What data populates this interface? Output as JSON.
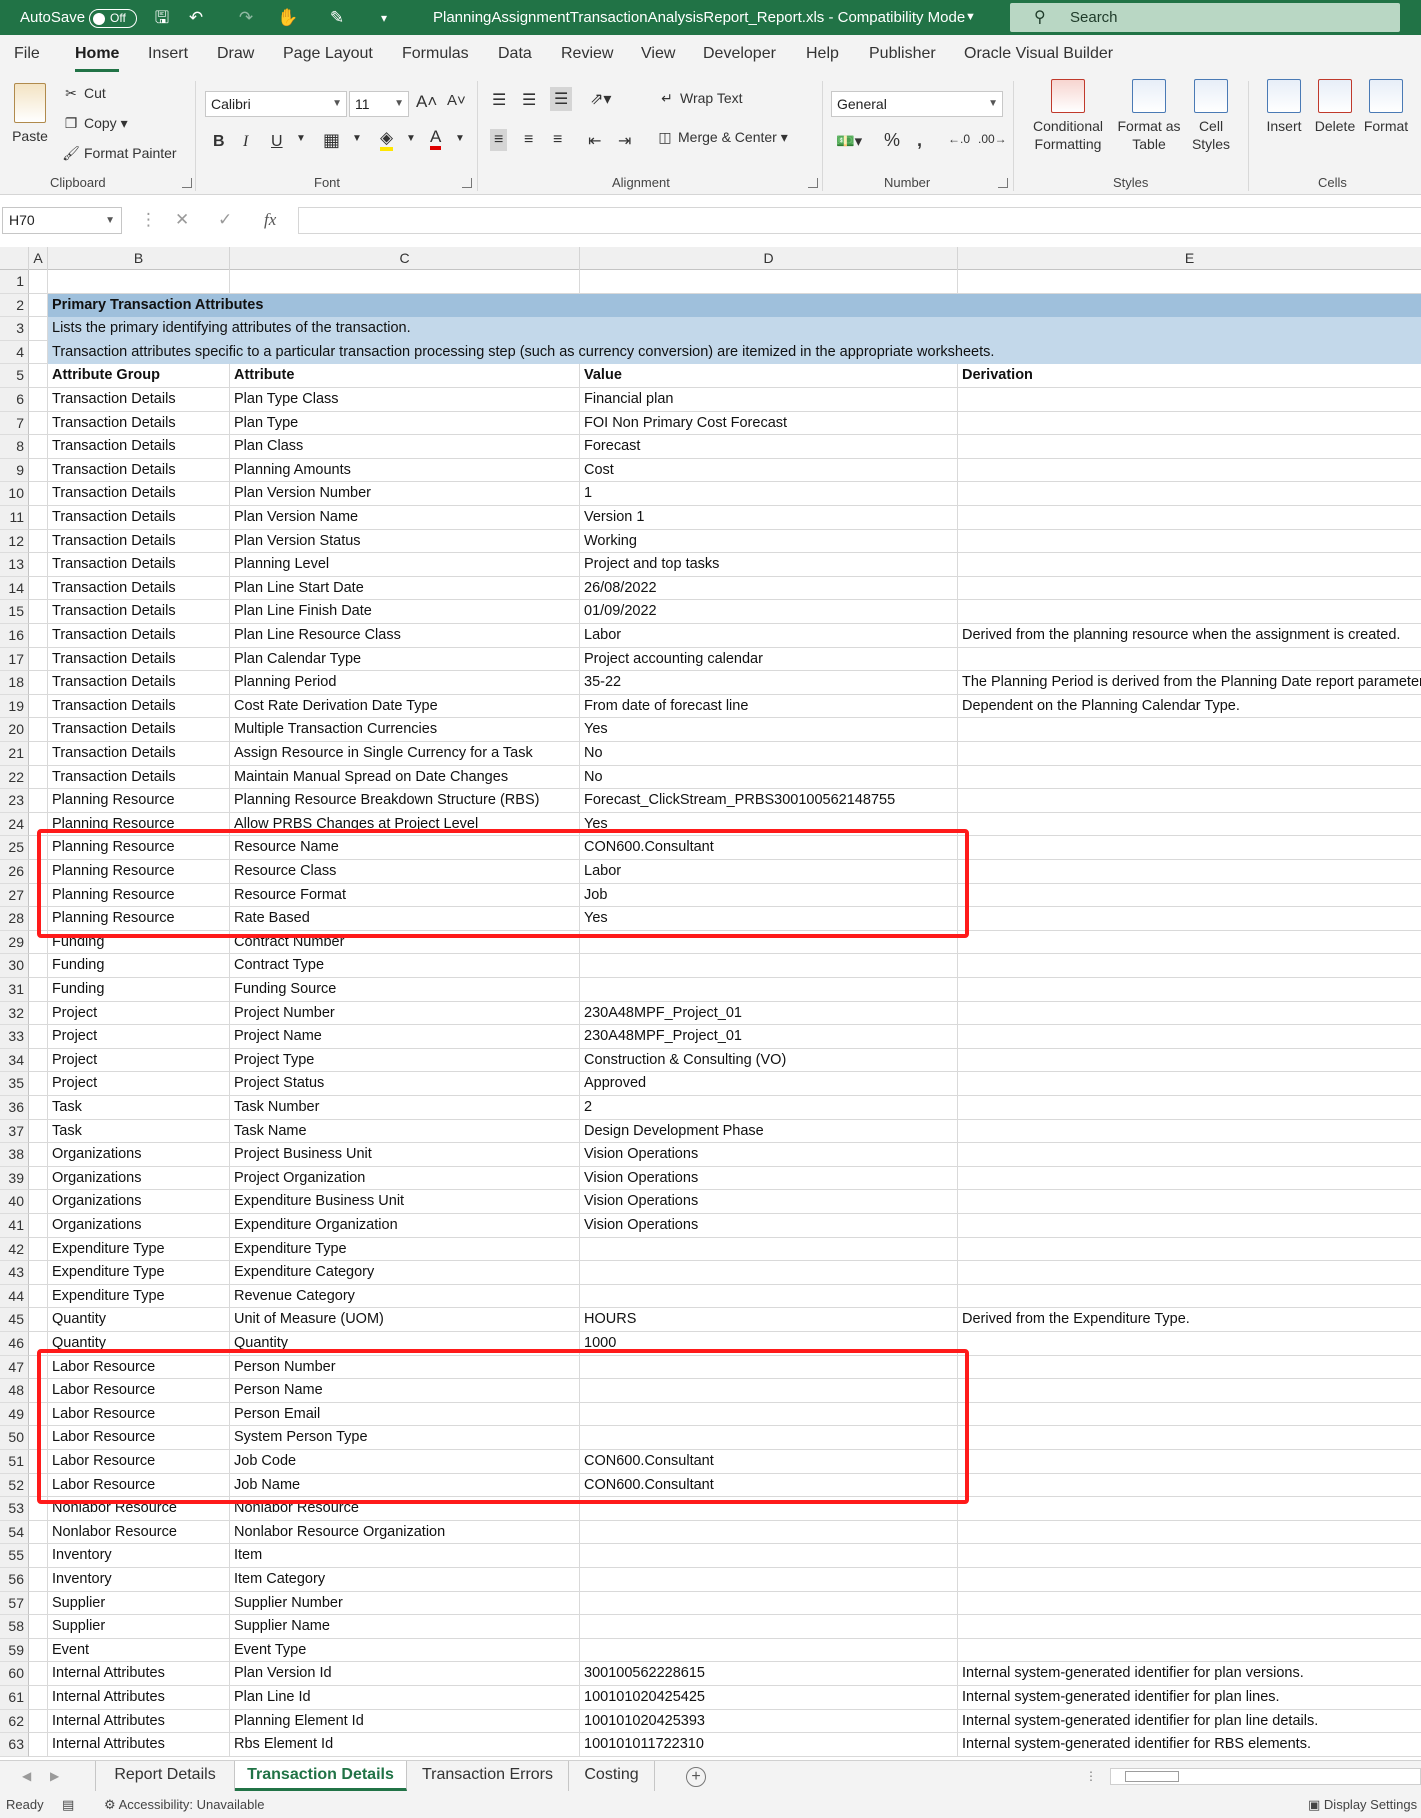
{
  "titlebar": {
    "autosave_label": "AutoSave",
    "autosave_state": "Off",
    "document_title": "PlanningAssignmentTransactionAnalysisReport_Report.xls  -  Compatibility Mode",
    "search_placeholder": "Search"
  },
  "menu": {
    "tabs": [
      "File",
      "Home",
      "Insert",
      "Draw",
      "Page Layout",
      "Formulas",
      "Data",
      "Review",
      "View",
      "Developer",
      "Help",
      "Publisher",
      "Oracle Visual Builder"
    ],
    "active": "Home"
  },
  "ribbon": {
    "clipboard": {
      "paste": "Paste",
      "cut": "Cut",
      "copy": "Copy",
      "format_painter": "Format Painter",
      "label": "Clipboard"
    },
    "font": {
      "name": "Calibri",
      "size": "11",
      "label": "Font",
      "bold": "B",
      "italic": "I",
      "underline": "U"
    },
    "alignment": {
      "wrap_text": "Wrap Text",
      "merge_center": "Merge & Center",
      "label": "Alignment"
    },
    "number": {
      "format": "General",
      "label": "Number"
    },
    "styles": {
      "conditional": "Conditional Formatting",
      "format_table": "Format as Table",
      "cell_styles": "Cell Styles",
      "label": "Styles"
    },
    "cells": {
      "insert": "Insert",
      "delete": "Delete",
      "format": "Format",
      "label": "Cells"
    }
  },
  "formula_bar": {
    "name_box": "H70",
    "fx": "fx",
    "value": ""
  },
  "columns": [
    "A",
    "B",
    "C",
    "D",
    "E"
  ],
  "sheet": {
    "title_row": "Primary Transaction Attributes",
    "desc_row_1": "Lists the primary identifying attributes of the transaction.",
    "desc_row_2": "Transaction attributes specific to a particular transaction processing step (such as currency conversion) are itemized in the appropriate worksheets.",
    "headers": [
      "Attribute Group",
      "Attribute",
      "Value",
      "Derivation"
    ],
    "rows": [
      [
        "Transaction Details",
        "Plan Type Class",
        "Financial plan",
        ""
      ],
      [
        "Transaction Details",
        "Plan Type",
        "FOI Non Primary Cost Forecast",
        ""
      ],
      [
        "Transaction Details",
        "Plan Class",
        "Forecast",
        ""
      ],
      [
        "Transaction Details",
        "Planning Amounts",
        "Cost",
        ""
      ],
      [
        "Transaction Details",
        "Plan Version Number",
        "1",
        ""
      ],
      [
        "Transaction Details",
        "Plan Version Name",
        "Version 1",
        ""
      ],
      [
        "Transaction Details",
        "Plan Version Status",
        "Working",
        ""
      ],
      [
        "Transaction Details",
        "Planning Level",
        "Project and top tasks",
        ""
      ],
      [
        "Transaction Details",
        "Plan Line Start Date",
        "26/08/2022",
        ""
      ],
      [
        "Transaction Details",
        "Plan Line Finish Date",
        "01/09/2022",
        ""
      ],
      [
        "Transaction Details",
        "Plan Line Resource Class",
        "Labor",
        "Derived from the planning resource when the assignment is created."
      ],
      [
        "Transaction Details",
        "Plan Calendar Type",
        "Project accounting calendar",
        ""
      ],
      [
        "Transaction Details",
        "Planning Period",
        "35-22",
        "The Planning Period is derived from the Planning Date report parameter."
      ],
      [
        "Transaction Details",
        "Cost Rate Derivation Date Type",
        "From date of forecast line",
        "Dependent on the Planning Calendar Type."
      ],
      [
        "Transaction Details",
        "Multiple Transaction Currencies",
        "Yes",
        ""
      ],
      [
        "Transaction Details",
        "Assign Resource in Single Currency for a Task",
        "No",
        ""
      ],
      [
        "Transaction Details",
        "Maintain Manual Spread on Date Changes",
        "No",
        ""
      ],
      [
        "Planning Resource",
        "Planning Resource Breakdown Structure (RBS)",
        "Forecast_ClickStream_PRBS300100562148755",
        ""
      ],
      [
        "Planning Resource",
        "Allow PRBS Changes at Project Level",
        "Yes",
        ""
      ],
      [
        "Planning Resource",
        "Resource Name",
        "CON600.Consultant",
        ""
      ],
      [
        "Planning Resource",
        "Resource Class",
        "Labor",
        ""
      ],
      [
        "Planning Resource",
        "Resource Format",
        "Job",
        ""
      ],
      [
        "Planning Resource",
        "Rate Based",
        "Yes",
        ""
      ],
      [
        "Funding",
        "Contract Number",
        "",
        ""
      ],
      [
        "Funding",
        "Contract Type",
        "",
        ""
      ],
      [
        "Funding",
        "Funding Source",
        "",
        ""
      ],
      [
        "Project",
        "Project Number",
        "230A48MPF_Project_01",
        ""
      ],
      [
        "Project",
        "Project Name",
        "230A48MPF_Project_01",
        ""
      ],
      [
        "Project",
        "Project Type",
        "Construction & Consulting (VO)",
        ""
      ],
      [
        "Project",
        "Project Status",
        "Approved",
        ""
      ],
      [
        "Task",
        "Task Number",
        "2",
        ""
      ],
      [
        "Task",
        "Task Name",
        "Design Development Phase",
        ""
      ],
      [
        "Organizations",
        "Project Business Unit",
        "Vision Operations",
        ""
      ],
      [
        "Organizations",
        "Project Organization",
        "Vision Operations",
        ""
      ],
      [
        "Organizations",
        "Expenditure Business Unit",
        "Vision Operations",
        ""
      ],
      [
        "Organizations",
        "Expenditure Organization",
        "Vision Operations",
        ""
      ],
      [
        "Expenditure Type",
        "Expenditure Type",
        "",
        ""
      ],
      [
        "Expenditure Type",
        "Expenditure Category",
        "",
        ""
      ],
      [
        "Expenditure Type",
        "Revenue Category",
        "",
        ""
      ],
      [
        "Quantity",
        "Unit of Measure (UOM)",
        "HOURS",
        "Derived from the Expenditure Type."
      ],
      [
        "Quantity",
        "Quantity",
        "1000",
        ""
      ],
      [
        "Labor Resource",
        "Person Number",
        "",
        ""
      ],
      [
        "Labor Resource",
        "Person Name",
        "",
        ""
      ],
      [
        "Labor Resource",
        "Person Email",
        "",
        ""
      ],
      [
        "Labor Resource",
        "System Person Type",
        "",
        ""
      ],
      [
        "Labor Resource",
        "Job Code",
        "CON600.Consultant",
        ""
      ],
      [
        "Labor Resource",
        "Job Name",
        "CON600.Consultant",
        ""
      ],
      [
        "Nonlabor Resource",
        "Nonlabor Resource",
        "",
        ""
      ],
      [
        "Nonlabor Resource",
        "Nonlabor Resource Organization",
        "",
        ""
      ],
      [
        "Inventory",
        "Item",
        "",
        ""
      ],
      [
        "Inventory",
        "Item Category",
        "",
        ""
      ],
      [
        "Supplier",
        "Supplier Number",
        "",
        ""
      ],
      [
        "Supplier",
        "Supplier Name",
        "",
        ""
      ],
      [
        "Event",
        "Event Type",
        "",
        ""
      ],
      [
        "Internal Attributes",
        "Plan Version Id",
        "300100562228615",
        "Internal system-generated identifier for plan versions."
      ],
      [
        "Internal Attributes",
        "Plan Line Id",
        "100101020425425",
        "Internal system-generated identifier for plan lines."
      ],
      [
        "Internal Attributes",
        "Planning Element Id",
        "100101020425393",
        "Internal system-generated identifier for plan line details."
      ],
      [
        "Internal Attributes",
        "Rbs Element Id",
        "100101011722310",
        "Internal system-generated identifier for RBS elements."
      ]
    ]
  },
  "sheet_tabs": [
    "Report Details",
    "Transaction Details",
    "Transaction Errors",
    "Costing"
  ],
  "active_sheet": "Transaction Details",
  "status": {
    "ready": "Ready",
    "accessibility": "Accessibility: Unavailable",
    "display_settings": "Display Settings"
  },
  "colors": {
    "brand": "#217346",
    "highlight": "#ff1a1a",
    "band_dark": "#9fc0dc",
    "band_light": "#c3d8ea"
  }
}
